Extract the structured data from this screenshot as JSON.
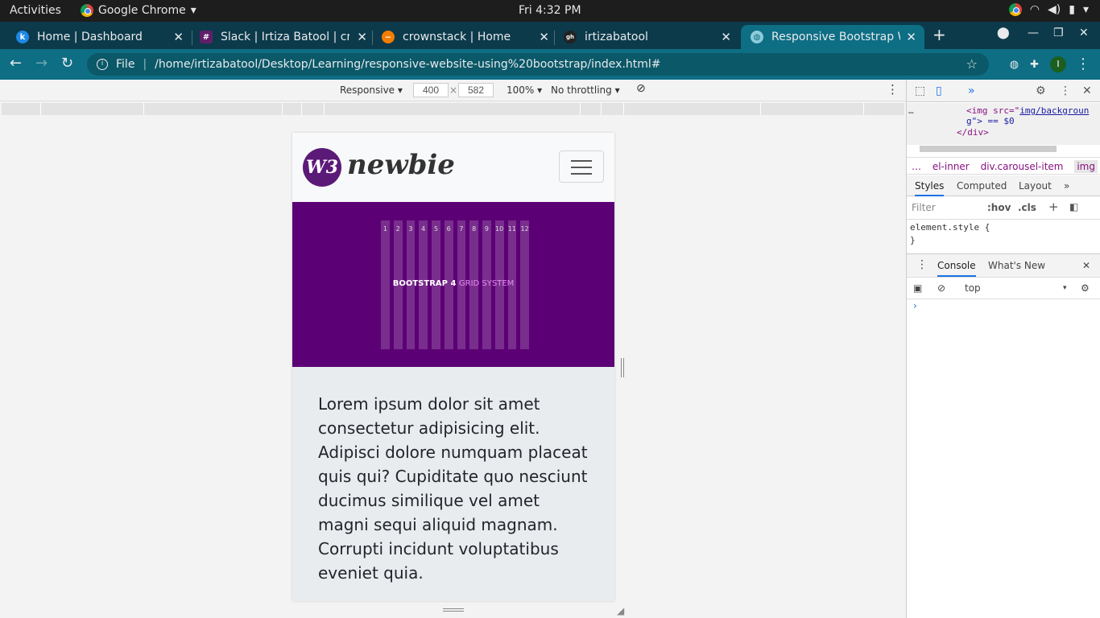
{
  "system": {
    "activities": "Activities",
    "app_name": "Google Chrome",
    "clock": "Fri  4:32 PM"
  },
  "tabs": [
    {
      "title": "Home | Dashboard",
      "favicon": "k"
    },
    {
      "title": "Slack | Irtiza Batool | cro",
      "favicon": "#"
    },
    {
      "title": "crownstack | Home",
      "favicon": "~"
    },
    {
      "title": "irtizabatool",
      "favicon": "gh"
    },
    {
      "title": "Responsive Bootstrap W",
      "favicon": "globe"
    }
  ],
  "address": {
    "file_label": "File",
    "separator": "|",
    "url": "/home/irtizabatool/Desktop/Learning/responsive-website-using%20bootstrap/index.html#"
  },
  "profile_initial": "I",
  "device": {
    "mode": "Responsive",
    "width": "400",
    "times": "×",
    "height": "582",
    "zoom": "100%",
    "throttle": "No throttling"
  },
  "site": {
    "logo_mark": "W3",
    "logo_text": "newbie",
    "hero_title_a": "BOOTSTRAP 4 ",
    "hero_title_b": "GRID SYSTEM",
    "grid_numbers": [
      "1",
      "2",
      "3",
      "4",
      "5",
      "6",
      "7",
      "8",
      "9",
      "10",
      "11",
      "12"
    ],
    "paragraph": "Lorem ipsum dolor sit amet consectetur adipisicing elit. Adipisci dolore numquam placeat quis qui? Cupiditate quo nesciunt ducimus similique vel amet magni sequi aliquid magnam. Corrupti incidunt voluptatibus eveniet quia."
  },
  "devtools": {
    "code_line1a": "<img src=\"",
    "code_line1b": "img/backgroun",
    "code_line2": "g\"> == $0",
    "code_line3": "</div>",
    "crumb_ellipsis": "…",
    "crumb1": "el-inner",
    "crumb2": "div.carousel-item",
    "crumb3": "img",
    "crumb_more": "…",
    "tab_styles": "Styles",
    "tab_computed": "Computed",
    "tab_layout": "Layout",
    "tab_more": "»",
    "filter_placeholder": "Filter",
    "hov": ":hov",
    "cls": ".cls",
    "rule1": "element.style {",
    "rule2": "}",
    "console_tab": "Console",
    "whatsnew_tab": "What's New",
    "context": "top",
    "prompt": "›"
  }
}
